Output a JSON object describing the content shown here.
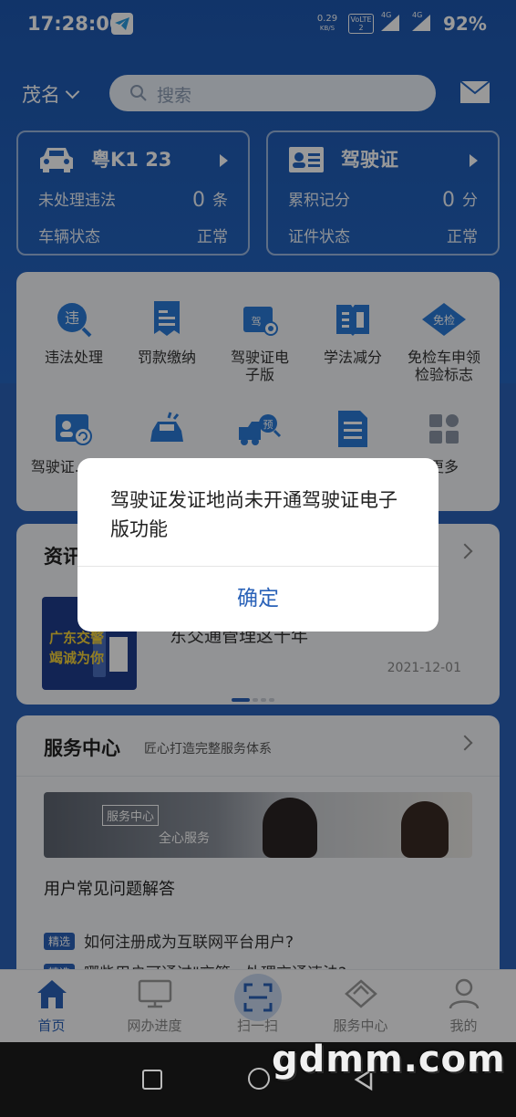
{
  "status_bar": {
    "time": "17:28:00",
    "speed_value": "0.29",
    "speed_unit": "KB/S",
    "volte": "VoLTE 2",
    "net1": "4G",
    "net2": "4G",
    "battery": "92%"
  },
  "topbar": {
    "city": "茂名",
    "search_placeholder": "搜索"
  },
  "vehicle_card": {
    "plate": "粤K1  23",
    "violations_label": "未处理违法",
    "violations_count": "0",
    "violations_unit": "条",
    "status_label": "车辆状态",
    "status_value": "正常"
  },
  "license_card": {
    "title": "驾驶证",
    "points_label": "累积记分",
    "points_value": "0",
    "points_unit": "分",
    "status_label": "证件状态",
    "status_value": "正常"
  },
  "services": [
    {
      "label": "违法处理",
      "icon": "violation-icon"
    },
    {
      "label": "罚款缴纳",
      "icon": "fine-icon"
    },
    {
      "label": "驾驶证电子版",
      "icon": "e-license-icon"
    },
    {
      "label": "学法减分",
      "icon": "book-icon"
    },
    {
      "label": "免检车申领检验标志",
      "icon": "inspection-free-icon"
    },
    {
      "label": "驾驶证...换...",
      "icon": "license-renew-icon"
    },
    {
      "label": "",
      "icon": "car-accident-icon"
    },
    {
      "label": "",
      "icon": "truck-search-icon"
    },
    {
      "label": "",
      "icon": "document-icon"
    },
    {
      "label": "更多",
      "icon": "more-grid-icon"
    }
  ],
  "news": {
    "title": "资讯",
    "thumb_text_line1": "广东交警",
    "thumb_text_line2": "竭诚为你",
    "headline": "东交通管理这十年",
    "date": "2021-12-01"
  },
  "service_center": {
    "title": "服务中心",
    "subtitle": "匠心打造完整服务体系",
    "banner_tag": "服务中心",
    "banner_text": "全心服务",
    "faq_title": "用户常见问题解答",
    "badge": "精选",
    "q1": "如何注册成为互联网平台用户?",
    "q2": "哪些用户可通过\"交管...处理交通违法?"
  },
  "bottom_nav": [
    {
      "label": "首页",
      "icon": "home-icon"
    },
    {
      "label": "网办进度",
      "icon": "monitor-icon"
    },
    {
      "label": "扫一扫",
      "icon": "scan-icon"
    },
    {
      "label": "服务中心",
      "icon": "service-center-icon"
    },
    {
      "label": "我的",
      "icon": "profile-icon"
    }
  ],
  "dialog": {
    "message": "驾驶证发证地尚未开通驾驶证电子版功能",
    "ok_label": "确定"
  },
  "watermark": "gdmm.com",
  "colors": {
    "primary_blue": "#2a62b8",
    "card_bg": "#f4f6f9"
  }
}
